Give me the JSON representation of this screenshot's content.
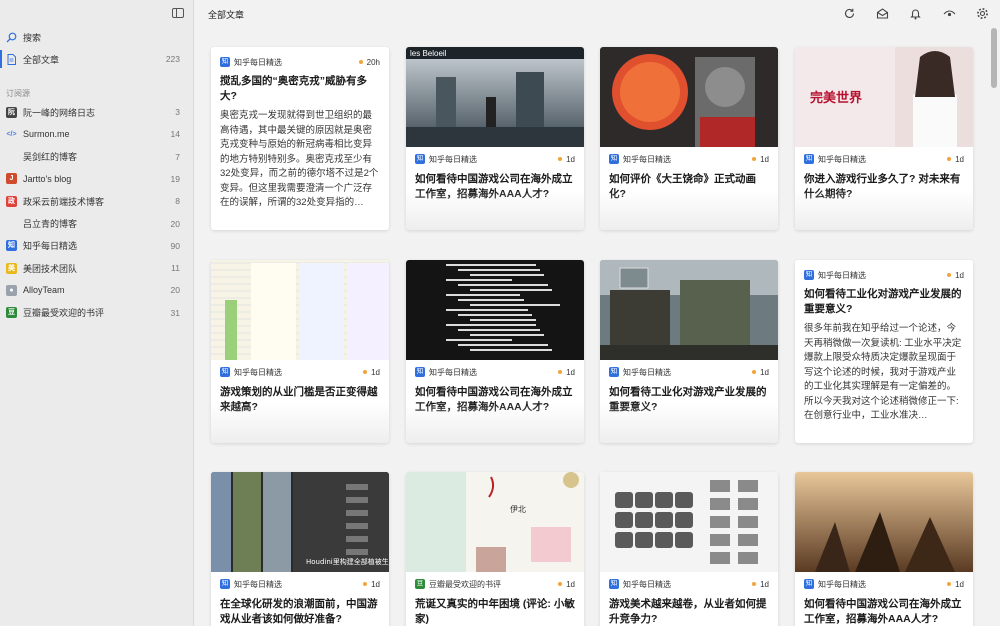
{
  "sidebar": {
    "search_label": "搜索",
    "all_articles": {
      "label": "全部文章",
      "count": "223"
    },
    "section_label": "订阅源",
    "feeds": [
      {
        "label": "阮一峰的网络日志",
        "count": "3",
        "icon": "ruanyf-logo",
        "color": "#444444",
        "glyph": "阮"
      },
      {
        "label": "Surmon.me",
        "count": "14",
        "icon": "code-icon",
        "color": "#4a7de0",
        "glyph": "</>"
      },
      {
        "label": "吴剑红的博客",
        "count": "7",
        "icon": "blank-icon",
        "color": "#ebebeb",
        "glyph": ""
      },
      {
        "label": "Jartto's blog",
        "count": "19",
        "icon": "jartto-logo",
        "color": "#d04a2e",
        "glyph": "J"
      },
      {
        "label": "政采云前端技术博客",
        "count": "8",
        "icon": "zcy-logo",
        "color": "#e0413a",
        "glyph": "政"
      },
      {
        "label": "吕立青的博客",
        "count": "20",
        "icon": "blank-icon",
        "color": "#ebebeb",
        "glyph": ""
      },
      {
        "label": "知乎每日精选",
        "count": "90",
        "icon": "zhihu-logo",
        "color": "#2f6fde",
        "glyph": "知"
      },
      {
        "label": "美团技术团队",
        "count": "11",
        "icon": "meituan-logo",
        "color": "#e9b81d",
        "glyph": "美"
      },
      {
        "label": "AlloyTeam",
        "count": "20",
        "icon": "alloyteam-logo",
        "color": "#9aa3ad",
        "glyph": "●"
      },
      {
        "label": "豆瓣最受欢迎的书评",
        "count": "31",
        "icon": "douban-logo",
        "color": "#2e8b3a",
        "glyph": "豆"
      }
    ]
  },
  "header": {
    "title": "全部文章",
    "icons": [
      "refresh-icon",
      "mark-all-read-icon",
      "notification-icon",
      "view-icon",
      "settings-icon"
    ]
  },
  "cards": [
    {
      "source": "知乎每日精选",
      "source_icon": "知",
      "time": "20h",
      "title": "搅乱多国的“奥密克戎”威胁有多大?",
      "excerpt": "奥密克戎一发现就得到世卫组织的最高待遇，其中最关键的原因就是奥密克戎变种与原始的新冠病毒相比变异的地方特别特别多。奥密克戎至少有32处变异，而之前的德尔塔不过是2个变异。但这里我需要澄清一个广泛存在的误解，所谓的32处变异指的…"
    },
    {
      "source": "知乎每日精选",
      "source_icon": "知",
      "time": "1d",
      "title": "如何看待中国游戏公司在海外成立工作室，招募海外AAA人才?",
      "thumb_text": "les Beloeil"
    },
    {
      "source": "知乎每日精选",
      "source_icon": "知",
      "time": "1d",
      "title": "如何评价《大王饶命》正式动画化?"
    },
    {
      "source": "知乎每日精选",
      "source_icon": "知",
      "time": "1d",
      "title": "你进入游戏行业多久了? 对未来有什么期待?",
      "thumb_text": "完美世界"
    },
    {
      "source": "知乎每日精选",
      "source_icon": "知",
      "time": "1d",
      "title": "游戏策划的从业门槛是否正变得越来越高?"
    },
    {
      "source": "知乎每日精选",
      "source_icon": "知",
      "time": "1d",
      "title": "如何看待中国游戏公司在海外成立工作室，招募海外AAA人才?"
    },
    {
      "source": "知乎每日精选",
      "source_icon": "知",
      "time": "1d",
      "title": "如何看待工业化对游戏产业发展的重要意义?"
    },
    {
      "source": "知乎每日精选",
      "source_icon": "知",
      "time": "1d",
      "title": "如何看待工业化对游戏产业发展的重要意义?",
      "excerpt": "很多年前我在知乎给过一个论述，今天再稍微做一次复读机: 工业水平决定爆款上限受众特质决定爆款呈现面于写这个论述的时候，我对于游戏产业的工业化其实理解是有一定偏差的。所以今天我对这个论述稍微修正一下: 在创意行业中，工业水准决…"
    },
    {
      "source": "知乎每日精选",
      "source_icon": "知",
      "time": "1d",
      "title": "在全球化研发的浪潮面前，中国游戏从业者该如何做好准备?",
      "thumb_text": "Houdini里构建全部植被生态"
    },
    {
      "source": "豆瓣最受欢迎的书评",
      "source_icon": "豆",
      "time": "1d",
      "title": "荒诞又真实的中年困境 (评论: 小敏家)",
      "thumb_text": "伊北"
    },
    {
      "source": "知乎每日精选",
      "source_icon": "知",
      "time": "1d",
      "title": "游戏美术越来越卷，从业者如何提升竞争力?"
    },
    {
      "source": "知乎每日精选",
      "source_icon": "知",
      "time": "1d",
      "title": "如何看待中国游戏公司在海外成立工作室，招募海外AAA人才?"
    }
  ]
}
